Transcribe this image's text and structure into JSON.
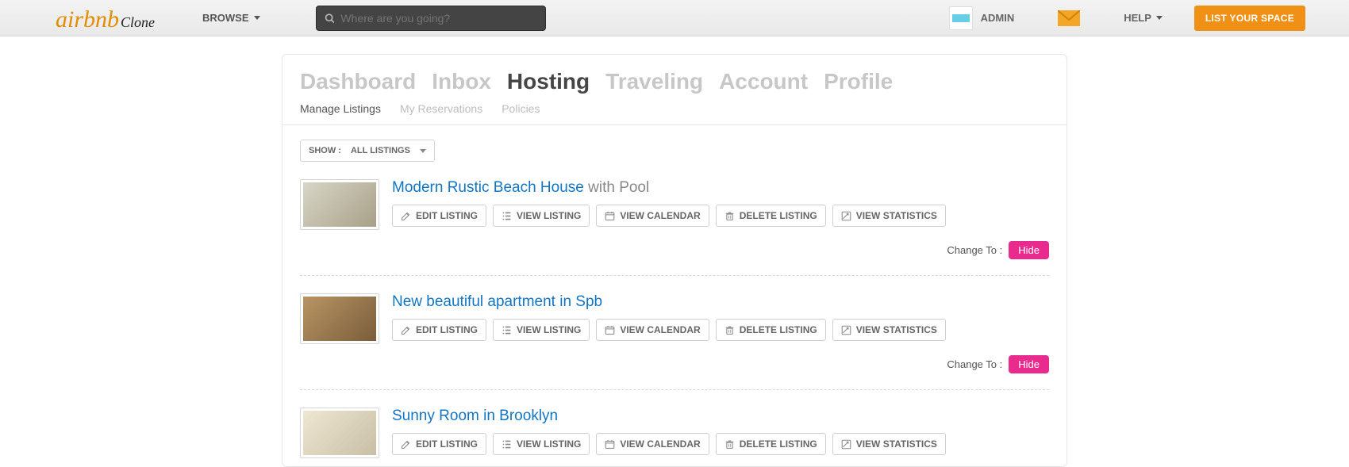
{
  "header": {
    "logo_main": "airbnb",
    "logo_sub": "Clone",
    "browse": "BROWSE",
    "search_placeholder": "Where are you going?",
    "admin": "ADMIN",
    "help": "HELP",
    "list_space": "LIST YOUR SPACE"
  },
  "tabs": {
    "items": [
      "Dashboard",
      "Inbox",
      "Hosting",
      "Traveling",
      "Account",
      "Profile"
    ],
    "active_index": 2
  },
  "subtabs": {
    "items": [
      "Manage Listings",
      "My Reservations",
      "Policies"
    ],
    "active_index": 0
  },
  "filter": {
    "show_label": "SHOW :",
    "value": "ALL LISTINGS"
  },
  "action_labels": {
    "edit": "EDIT LISTING",
    "view": "VIEW LISTING",
    "calendar": "VIEW CALENDAR",
    "delete": "DELETE LISTING",
    "stats": "VIEW STATISTICS"
  },
  "change_to": "Change To  :",
  "hide": "Hide",
  "listings": [
    {
      "title_main": "Modern Rustic Beach House",
      "title_extra": "with Pool",
      "thumb_color": "linear-gradient(135deg,#d8d6c8,#a8a087)"
    },
    {
      "title_main": "New beautiful apartment in Spb",
      "title_extra": "",
      "thumb_color": "linear-gradient(135deg,#b89563,#7a5d3b)"
    },
    {
      "title_main": "Sunny Room in Brooklyn",
      "title_extra": "",
      "thumb_color": "linear-gradient(135deg,#efe7d3,#c9bfa6)"
    }
  ]
}
